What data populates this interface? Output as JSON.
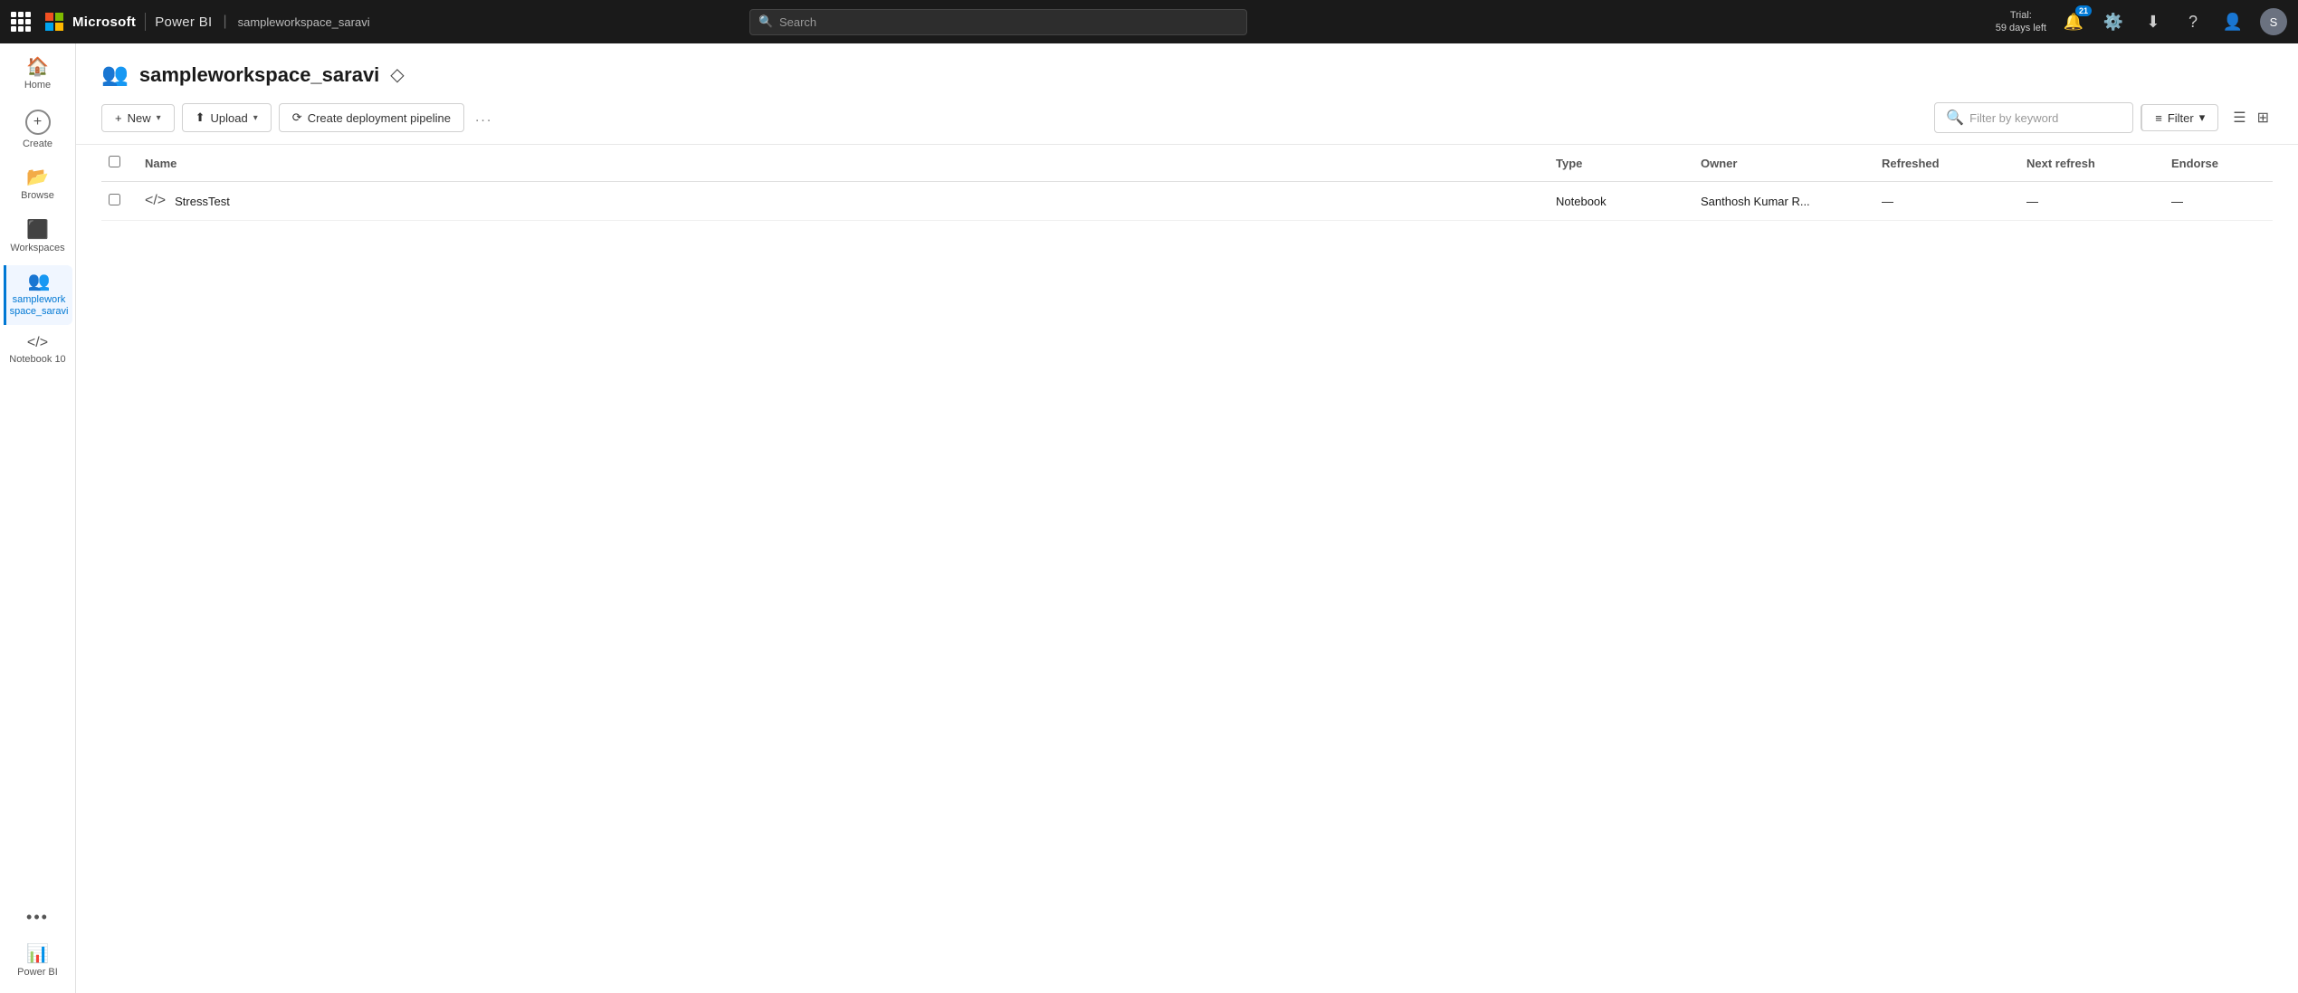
{
  "topbar": {
    "brand": "Microsoft",
    "product": "Power BI",
    "workspace": "sampleworkspace_saravi",
    "search_placeholder": "Search",
    "trial_line1": "Trial:",
    "trial_line2": "59 days left",
    "notif_count": "21"
  },
  "sidebar": {
    "items": [
      {
        "id": "home",
        "label": "Home",
        "icon": "🏠"
      },
      {
        "id": "create",
        "label": "Create",
        "icon": "➕"
      },
      {
        "id": "browse",
        "label": "Browse",
        "icon": "📁"
      },
      {
        "id": "workspaces",
        "label": "Workspaces",
        "icon": "⬛"
      },
      {
        "id": "sampleworkspace",
        "label": "samplework space_saravi",
        "icon": "👥",
        "active": true
      },
      {
        "id": "notebook10",
        "label": "Notebook 10",
        "icon": "⌨️"
      }
    ],
    "more_label": "...",
    "bottom_label": "Power BI",
    "bottom_icon": "📊"
  },
  "content": {
    "workspace_icon": "👥",
    "workspace_title": "sampleworkspace_saravi",
    "diamond_icon": "◇",
    "toolbar": {
      "new_label": "New",
      "upload_label": "Upload",
      "pipeline_label": "Create deployment pipeline",
      "more_label": "...",
      "filter_placeholder": "Filter by keyword",
      "filter_btn_label": "Filter"
    },
    "table": {
      "columns": [
        "Name",
        "Type",
        "Owner",
        "Refreshed",
        "Next refresh",
        "Endorse"
      ],
      "rows": [
        {
          "name": "StressTest",
          "type": "Notebook",
          "owner": "Santhosh Kumar R...",
          "refreshed": "—",
          "next_refresh": "—",
          "endorse": "—"
        }
      ]
    }
  }
}
